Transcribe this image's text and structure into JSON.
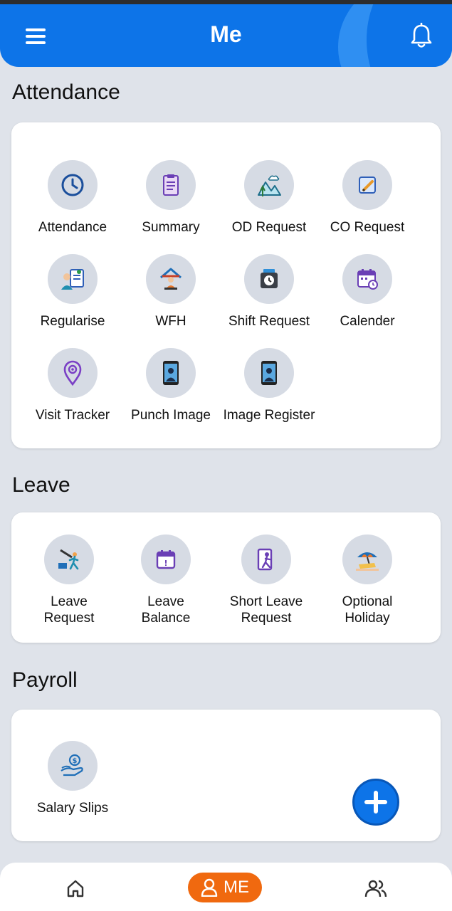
{
  "header": {
    "title": "Me"
  },
  "sections": {
    "attendance": {
      "title": "Attendance",
      "items": [
        {
          "label": "Attendance",
          "icon": "clock-icon"
        },
        {
          "label": "Summary",
          "icon": "clipboard-icon"
        },
        {
          "label": "OD Request",
          "icon": "outdoor-icon"
        },
        {
          "label": "CO Request",
          "icon": "compoff-icon"
        },
        {
          "label": "Regularise",
          "icon": "regularise-icon"
        },
        {
          "label": "WFH",
          "icon": "home-office-icon"
        },
        {
          "label": "Shift Request",
          "icon": "shift-clock-icon"
        },
        {
          "label": "Calender",
          "icon": "calendar-icon"
        },
        {
          "label": "Visit Tracker",
          "icon": "location-pin-icon"
        },
        {
          "label": "Punch Image",
          "icon": "phone-selfie-icon"
        },
        {
          "label": "Image Register",
          "icon": "phone-selfie-icon"
        }
      ]
    },
    "leave": {
      "title": "Leave",
      "items": [
        {
          "line1": "Leave",
          "line2": "Request",
          "icon": "leave-request-icon"
        },
        {
          "line1": "Leave",
          "line2": "Balance",
          "icon": "leave-balance-icon"
        },
        {
          "line1": "Short Leave",
          "line2": "Request",
          "icon": "short-leave-icon"
        },
        {
          "line1": "Optional",
          "line2": "Holiday",
          "icon": "beach-umbrella-icon"
        }
      ]
    },
    "payroll": {
      "title": "Payroll",
      "items": [
        {
          "label": "Salary Slips",
          "icon": "salary-hand-icon"
        }
      ]
    }
  },
  "bottom_nav": {
    "me_label": "ME"
  },
  "colors": {
    "primary": "#0d74e8",
    "accent": "#f0690f",
    "background": "#dfe3ea"
  }
}
